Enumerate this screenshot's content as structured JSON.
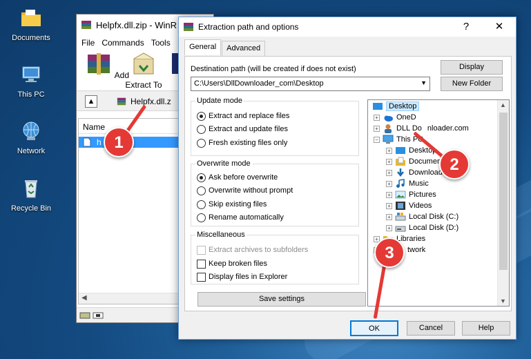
{
  "desktop": {
    "icons": [
      {
        "label": "Documents",
        "icon": "folder-icon"
      },
      {
        "label": "This PC",
        "icon": "computer-icon"
      },
      {
        "label": "Network",
        "icon": "network-icon"
      },
      {
        "label": "Recycle Bin",
        "icon": "recycle-bin-icon"
      }
    ]
  },
  "winrar": {
    "title": "Helpfx.dll.zip - WinR",
    "menu": [
      "File",
      "Commands",
      "Tools"
    ],
    "tool_add": "Add",
    "tool_extract": "Extract To",
    "tool_partial": "T",
    "address": "Helpfx.dll.z",
    "column_name": "Name",
    "row_file": "h",
    "row_file_tail": "ll"
  },
  "dialog": {
    "title": "Extraction path and options",
    "help_glyph": "?",
    "close_glyph": "✕",
    "tabs": [
      "General",
      "Advanced"
    ],
    "dest_label": "Destination path (will be created if does not exist)",
    "dest_value": "C:\\Users\\DllDownloader_com\\Desktop",
    "display_button": "Display",
    "new_folder_button": "New Folder",
    "update_mode": {
      "legend": "Update mode",
      "options": [
        "Extract and replace files",
        "Extract and update files",
        "Fresh existing files only"
      ],
      "selected": 0
    },
    "overwrite_mode": {
      "legend": "Overwrite mode",
      "options": [
        "Ask before overwrite",
        "Overwrite without prompt",
        "Skip existing files",
        "Rename automatically"
      ],
      "selected": 0
    },
    "misc": {
      "legend": "Miscellaneous",
      "options": [
        "Extract archives to subfolders",
        "Keep broken files",
        "Display files in Explorer"
      ]
    },
    "save_settings": "Save settings",
    "tree": [
      {
        "label": "Desktop",
        "selected": true
      },
      {
        "label": "OneD"
      },
      {
        "label": "DLL Do",
        "label_tail": "nloader.com"
      },
      {
        "label": "This PC"
      },
      {
        "label": "Desktop"
      },
      {
        "label": "Documents"
      },
      {
        "label": "Downloads"
      },
      {
        "label": "Music"
      },
      {
        "label": "Pictures"
      },
      {
        "label": "Videos"
      },
      {
        "label": "Local Disk (C:)"
      },
      {
        "label": "Local Disk (D:)"
      },
      {
        "label": "Libraries"
      },
      {
        "label": "twork"
      }
    ],
    "ok": "OK",
    "cancel": "Cancel",
    "help": "Help"
  },
  "annotations": [
    "1",
    "2",
    "3"
  ],
  "colors": {
    "accent": "#e53935",
    "selection": "#3399ff",
    "selection_tree": "#cce8ff"
  }
}
